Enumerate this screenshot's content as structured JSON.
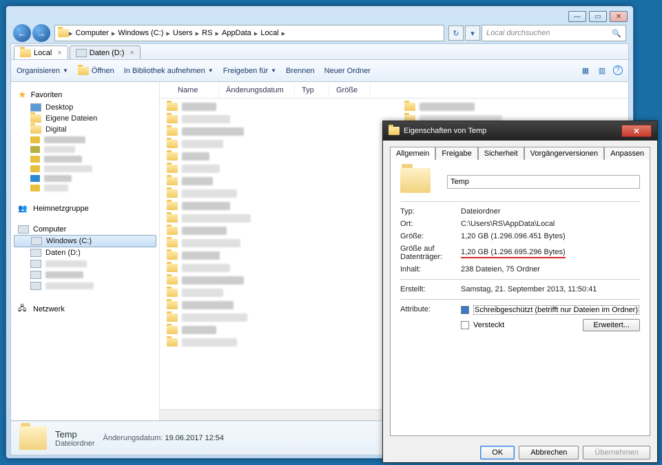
{
  "window": {
    "min": "—",
    "max": "▭",
    "close": "✕"
  },
  "nav": {
    "back": "←",
    "fwd": "→"
  },
  "breadcrumb": [
    "Computer",
    "Windows (C:)",
    "Users",
    "RS",
    "AppData",
    "Local"
  ],
  "search": {
    "placeholder": "Local durchsuchen"
  },
  "tabs": [
    {
      "icon": "folder",
      "label": "Local"
    },
    {
      "icon": "drive",
      "label": "Daten (D:)"
    }
  ],
  "toolbar": {
    "organize": "Organisieren",
    "open": "Öffnen",
    "library": "In Bibliothek aufnehmen",
    "share": "Freigeben für",
    "burn": "Brennen",
    "newfolder": "Neuer Ordner"
  },
  "columns": {
    "name": "Name",
    "date": "Änderungsdatum",
    "type": "Typ",
    "size": "Größe"
  },
  "sidebar": {
    "favorites": "Favoriten",
    "desktop": "Desktop",
    "documents": "Eigene Dateien",
    "digital": "Digital",
    "homegroup": "Heimnetzgruppe",
    "computer": "Computer",
    "windows_c": "Windows (C:)",
    "daten_d": "Daten (D:)",
    "network": "Netzwerk"
  },
  "highlighted_folder": "Temp",
  "details": {
    "name": "Temp",
    "type": "Dateiordner",
    "date_label": "Änderungsdatum:",
    "date": "19.06.2017 12:54"
  },
  "props": {
    "title": "Eigenschaften von Temp",
    "tabs": {
      "general": "Allgemein",
      "share": "Freigabe",
      "security": "Sicherheit",
      "versions": "Vorgängerversionen",
      "customize": "Anpassen"
    },
    "name": "Temp",
    "type_l": "Typ:",
    "type": "Dateiordner",
    "loc_l": "Ort:",
    "loc": "C:\\Users\\RS\\AppData\\Local",
    "size_l": "Größe:",
    "size": "1,20 GB (1.296.096.451 Bytes)",
    "disk_l": "Größe auf Datenträger:",
    "disk": "1,20 GB (1.296.695.296 Bytes)",
    "content_l": "Inhalt:",
    "content": "238 Dateien, 75 Ordner",
    "created_l": "Erstellt:",
    "created": "Samstag, 21. September 2013, 11:50:41",
    "attr_l": "Attribute:",
    "readonly": "Schreibgeschützt (betrifft nur Dateien im Ordner)",
    "hidden": "Versteckt",
    "advanced": "Erweitert...",
    "ok": "OK",
    "cancel": "Abbrechen",
    "apply": "Übernehmen"
  }
}
